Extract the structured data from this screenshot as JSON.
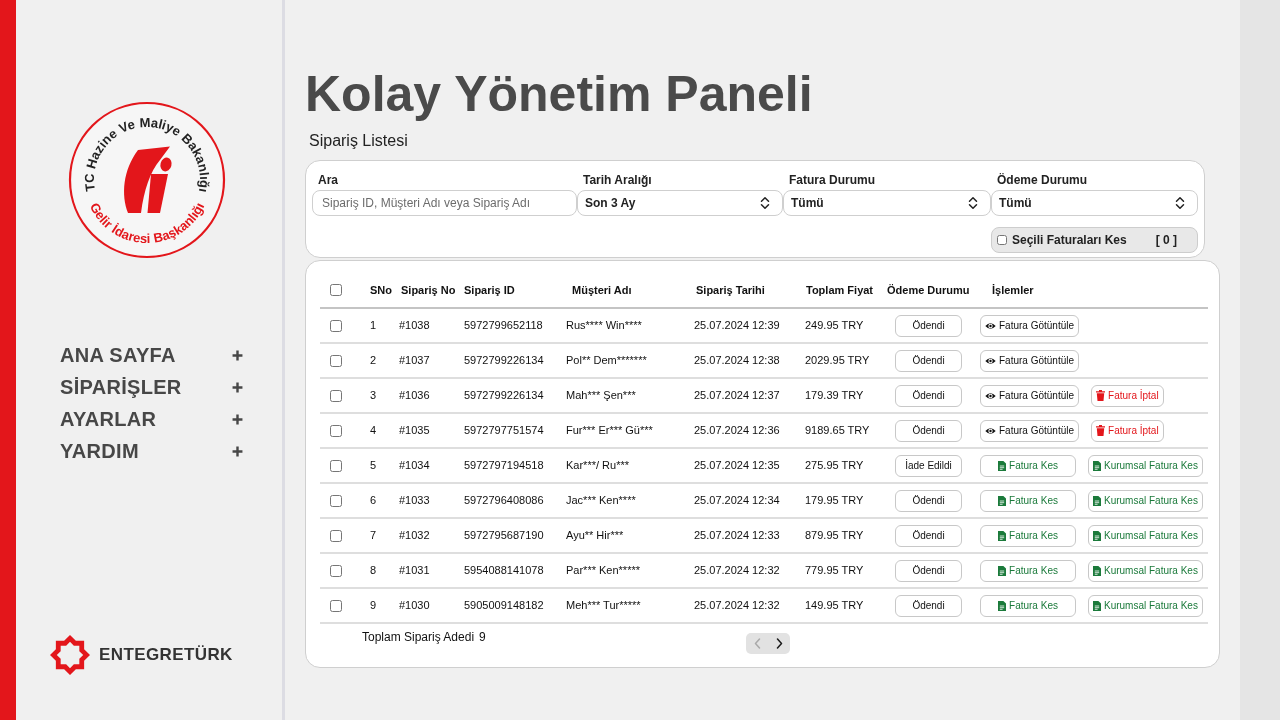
{
  "sidebar": {
    "logo": {
      "top_words": [
        "TC",
        "Hazine",
        "Ve",
        "Maliye",
        "Bakanlığı"
      ],
      "bottom_words": [
        "Gelir",
        "İdaresi",
        "Başkanlığı"
      ]
    },
    "nav_items": [
      {
        "label": "ANA SAYFA",
        "expanded": false
      },
      {
        "label": "SİPARİŞLER",
        "expanded": false
      },
      {
        "label": "AYARLAR",
        "expanded": false
      },
      {
        "label": "YARDIM",
        "expanded": false
      }
    ],
    "brand": "ENTEGRETÜRK"
  },
  "page_title": "Kolay Yönetim Paneli",
  "section_title": "Sipariş Listesi",
  "filters": [
    {
      "kind": "search",
      "label": "Ara",
      "placeholder": "Sipariş ID, Müşteri Adı veya Sipariş Adı"
    },
    {
      "kind": "select",
      "label": "Tarih Aralığı",
      "value": "Son 3 Ay"
    },
    {
      "kind": "select",
      "label": "Fatura Durumu",
      "value": "Tümü"
    },
    {
      "kind": "select",
      "label": "Ödeme Durumu",
      "value": "Tümü"
    }
  ],
  "bulk_invoice": {
    "checked": false,
    "label": "Seçili Faturaları Kes",
    "count": "[ 0 ]"
  },
  "table": {
    "select_all": {
      "checked": false
    },
    "columns": [
      "SNo",
      "Sipariş No",
      "Sipariş ID",
      "Müşteri Adı",
      "Sipariş Tarihi",
      "Toplam Fiyat",
      "Ödeme Durumu",
      "İşlemler"
    ],
    "rows": [
      {
        "checked": false,
        "sno": "1",
        "order_no": "#1038",
        "order_id": "5972799652118",
        "customer": "Rus**** Win****",
        "date": "25.07.2024 12:39",
        "total": "249.95 TRY",
        "payment_status": "Ödendi",
        "actions": [
          {
            "kind": "view",
            "label": "Fatura Götüntüle"
          }
        ]
      },
      {
        "checked": false,
        "sno": "2",
        "order_no": "#1037",
        "order_id": "5972799226134",
        "customer": "Pol** Dem*******",
        "date": "25.07.2024 12:38",
        "total": "2029.95 TRY",
        "payment_status": "Ödendi",
        "actions": [
          {
            "kind": "view",
            "label": "Fatura Götüntüle"
          }
        ]
      },
      {
        "checked": false,
        "sno": "3",
        "order_no": "#1036",
        "order_id": "5972799226134",
        "customer": "Mah*** Şen***",
        "date": "25.07.2024 12:37",
        "total": "179.39 TRY",
        "payment_status": "Ödendi",
        "actions": [
          {
            "kind": "view",
            "label": "Fatura Götüntüle"
          },
          {
            "kind": "cancel",
            "label": "Fatura İptal"
          }
        ]
      },
      {
        "checked": false,
        "sno": "4",
        "order_no": "#1035",
        "order_id": "5972797751574",
        "customer": "Fur*** Er*** Gü***",
        "date": "25.07.2024 12:36",
        "total": "9189.65 TRY",
        "payment_status": "Ödendi",
        "actions": [
          {
            "kind": "view",
            "label": "Fatura Götüntüle"
          },
          {
            "kind": "cancel",
            "label": "Fatura İptal"
          }
        ]
      },
      {
        "checked": false,
        "sno": "5",
        "order_no": "#1034",
        "order_id": "5972797194518",
        "customer": "Kar***/ Ru***",
        "date": "25.07.2024 12:35",
        "total": "275.95 TRY",
        "payment_status": "İade Edildi",
        "actions": [
          {
            "kind": "invoice",
            "label": "Fatura Kes"
          },
          {
            "kind": "corporate_invoice",
            "label": "Kurumsal Fatura Kes"
          }
        ]
      },
      {
        "checked": false,
        "sno": "6",
        "order_no": "#1033",
        "order_id": "5972796408086",
        "customer": "Jac*** Ken****",
        "date": "25.07.2024 12:34",
        "total": "179.95 TRY",
        "payment_status": "Ödendi",
        "actions": [
          {
            "kind": "invoice",
            "label": "Fatura Kes"
          },
          {
            "kind": "corporate_invoice",
            "label": "Kurumsal Fatura Kes"
          }
        ]
      },
      {
        "checked": false,
        "sno": "7",
        "order_no": "#1032",
        "order_id": "5972795687190",
        "customer": "Ayu** Hir***",
        "date": "25.07.2024 12:33",
        "total": "879.95 TRY",
        "payment_status": "Ödendi",
        "actions": [
          {
            "kind": "invoice",
            "label": "Fatura Kes"
          },
          {
            "kind": "corporate_invoice",
            "label": "Kurumsal Fatura Kes"
          }
        ]
      },
      {
        "checked": false,
        "sno": "8",
        "order_no": "#1031",
        "order_id": "5954088141078",
        "customer": "Par*** Ken*****",
        "date": "25.07.2024 12:32",
        "total": "779.95 TRY",
        "payment_status": "Ödendi",
        "actions": [
          {
            "kind": "invoice",
            "label": "Fatura Kes"
          },
          {
            "kind": "corporate_invoice",
            "label": "Kurumsal Fatura Kes"
          }
        ]
      },
      {
        "checked": false,
        "sno": "9",
        "order_no": "#1030",
        "order_id": "5905009148182",
        "customer": "Meh*** Tur*****",
        "date": "25.07.2024 12:32",
        "total": "149.95 TRY",
        "payment_status": "Ödendi",
        "actions": [
          {
            "kind": "invoice",
            "label": "Fatura Kes"
          },
          {
            "kind": "corporate_invoice",
            "label": "Kurumsal Fatura Kes"
          }
        ]
      }
    ]
  },
  "footer": {
    "total_label": "Toplam Sipariş Adedi",
    "total_count": "9"
  },
  "pagination": [
    {
      "kind": "prev",
      "disabled": true
    },
    {
      "kind": "next",
      "disabled": false
    }
  ]
}
